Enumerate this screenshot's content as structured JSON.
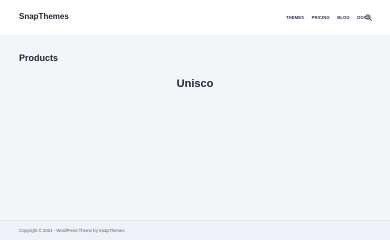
{
  "header": {
    "logo": "SnapThemes",
    "nav": [
      "THEMES",
      "PRICING",
      "BLOG",
      "DOCS"
    ],
    "search_icon": "search-icon"
  },
  "main": {
    "page_title": "Products",
    "product_title": "Unisco"
  },
  "footer": {
    "copyright": "Copyright © 2024 - WordPress Theme by SnapThemes"
  }
}
